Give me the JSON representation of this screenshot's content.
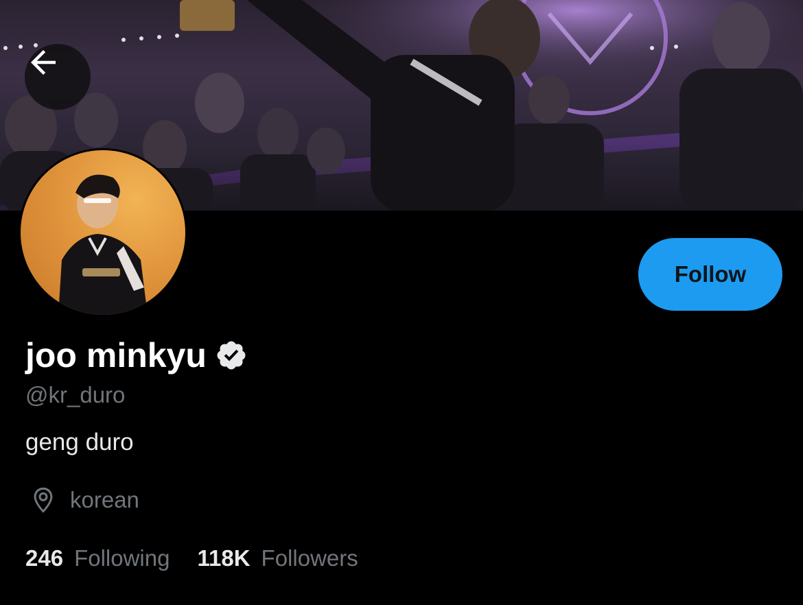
{
  "profile": {
    "display_name": "joo minkyu",
    "handle": "@kr_duro",
    "bio": "geng duro",
    "location": "korean",
    "following_count": "246",
    "following_label": "Following",
    "followers_count": "118K",
    "followers_label": "Followers"
  },
  "actions": {
    "follow_label": "Follow"
  },
  "icons": {
    "back": "back-arrow-icon",
    "verified": "verified-badge-icon",
    "location": "location-pin-icon"
  },
  "colors": {
    "background": "#000000",
    "accent": "#1d9bf0",
    "secondary_text": "#71767b",
    "primary_text": "#e7e9ea"
  }
}
